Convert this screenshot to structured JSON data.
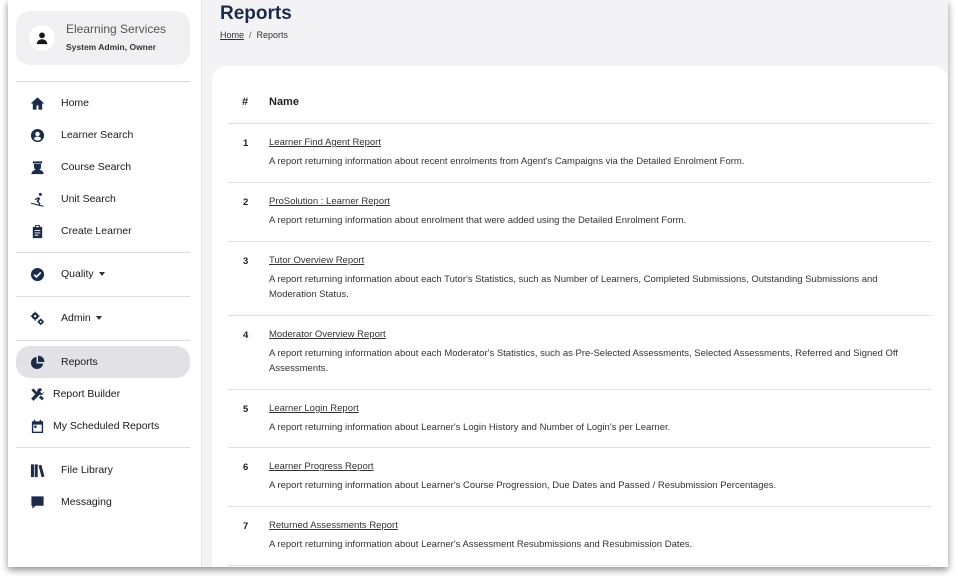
{
  "profile": {
    "name": "Elearning Services",
    "role": "System Admin, Owner"
  },
  "sidebar": {
    "items": [
      {
        "label": "Home",
        "icon": "home-icon"
      },
      {
        "label": "Learner Search",
        "icon": "user-circle-icon"
      },
      {
        "label": "Course Search",
        "icon": "graduation-cap-icon"
      },
      {
        "label": "Unit Search",
        "icon": "skier-icon"
      },
      {
        "label": "Create Learner",
        "icon": "clipboard-icon"
      },
      {
        "label": "Quality",
        "icon": "check-circle-icon"
      },
      {
        "label": "Admin",
        "icon": "gears-icon"
      },
      {
        "label": "Reports",
        "icon": "pie-chart-icon"
      },
      {
        "label": "Report Builder",
        "icon": "tools-icon"
      },
      {
        "label": "My Scheduled Reports",
        "icon": "calendar-icon"
      },
      {
        "label": "File Library",
        "icon": "books-icon"
      },
      {
        "label": "Messaging",
        "icon": "message-icon"
      }
    ]
  },
  "page": {
    "title": "Reports",
    "breadcrumb": {
      "home": "Home",
      "separator": "/",
      "current": "Reports"
    }
  },
  "table": {
    "headers": {
      "num": "#",
      "name": "Name"
    },
    "rows": [
      {
        "num": "1",
        "name": "Learner Find Agent Report",
        "desc": "A report returning information about recent enrolments from Agent's Campaigns via the Detailed Enrolment Form."
      },
      {
        "num": "2",
        "name": "ProSolution : Learner Report",
        "desc": "A report returning information about enrolment that were added using the Detailed Enrolment Form."
      },
      {
        "num": "3",
        "name": "Tutor Overview Report",
        "desc": "A report returning information about each Tutor's Statistics, such as Number of Learners, Completed Submissions, Outstanding Submissions and Moderation Status."
      },
      {
        "num": "4",
        "name": "Moderator Overview Report",
        "desc": "A report returning information about each Moderator's Statistics, such as Pre-Selected Assessments, Selected Assessments, Referred and Signed Off Assessments."
      },
      {
        "num": "5",
        "name": "Learner Login Report",
        "desc": "A report returning information about Learner's Login History and Number of Login's per Learner."
      },
      {
        "num": "6",
        "name": "Learner Progress Report",
        "desc": "A report returning information about Learner's Course Progression, Due Dates and Passed / Resubmission Percentages."
      },
      {
        "num": "7",
        "name": "Returned Assessments Report",
        "desc": "A report returning information about Learner's Assessment Resubmissions and Resubmission Dates."
      }
    ]
  },
  "colors": {
    "title": "#1c2b48",
    "active_nav_bg": "#e1e1e6",
    "page_bg": "#f3f3f5"
  }
}
